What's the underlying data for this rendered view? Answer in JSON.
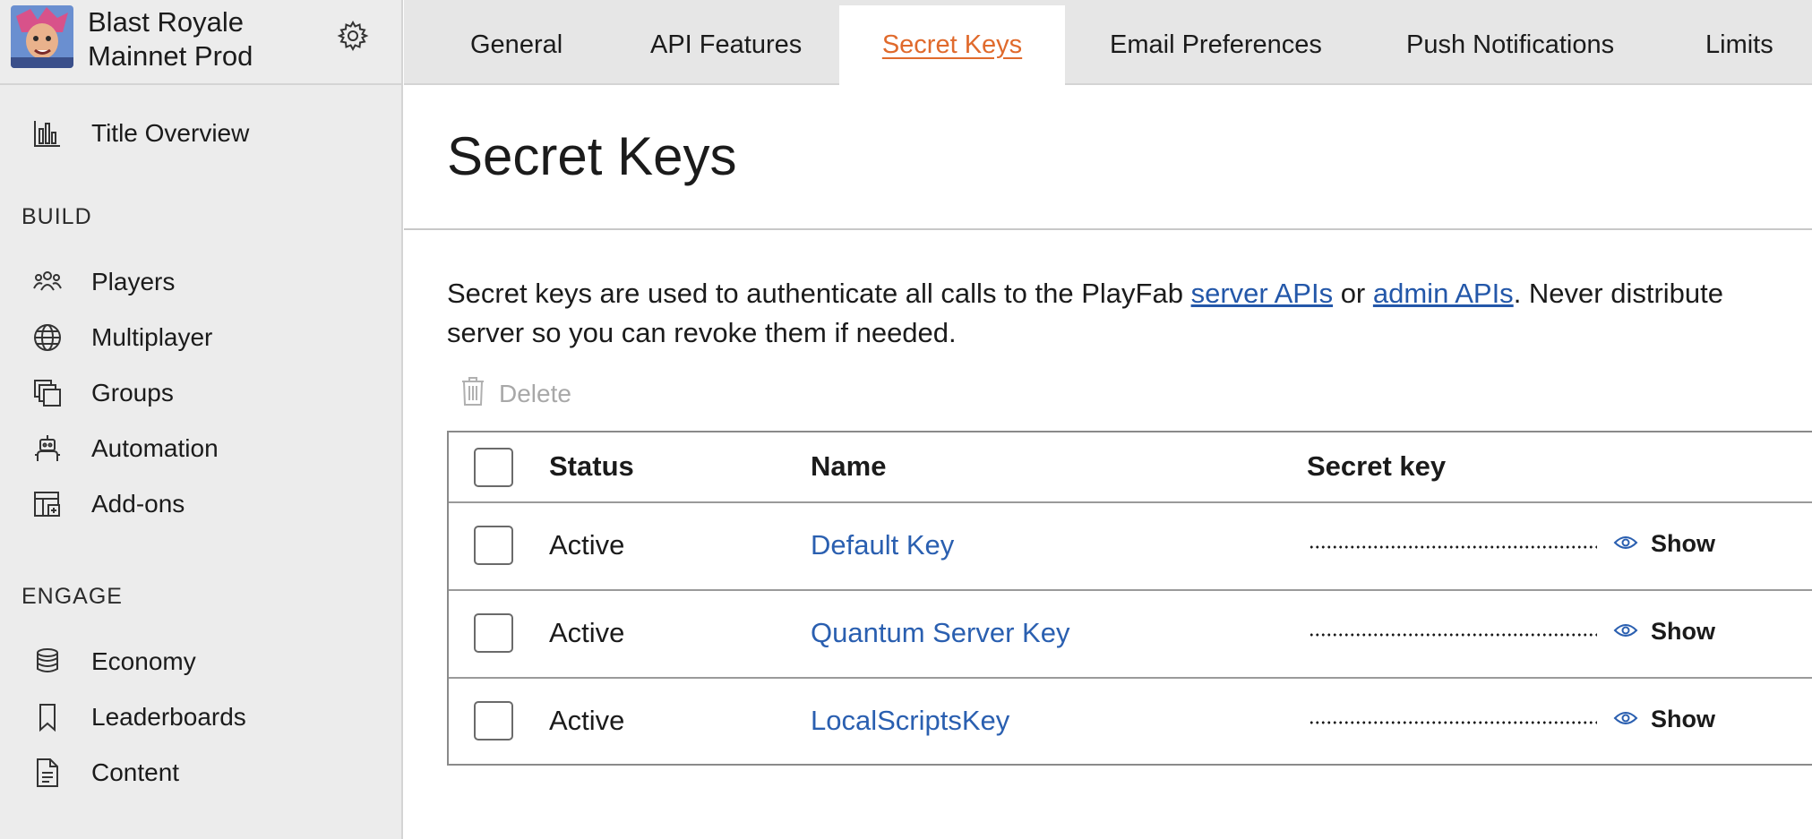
{
  "app": {
    "title_line1": "Blast Royale",
    "title_line2": "Mainnet Prod"
  },
  "sidebar": {
    "overview_label": "Title Overview",
    "build_heading": "BUILD",
    "build_items": [
      {
        "label": "Players",
        "icon": "players-icon"
      },
      {
        "label": "Multiplayer",
        "icon": "globe-icon"
      },
      {
        "label": "Groups",
        "icon": "groups-icon"
      },
      {
        "label": "Automation",
        "icon": "robot-icon"
      },
      {
        "label": "Add-ons",
        "icon": "addons-icon"
      }
    ],
    "engage_heading": "ENGAGE",
    "engage_items": [
      {
        "label": "Economy",
        "icon": "coins-icon"
      },
      {
        "label": "Leaderboards",
        "icon": "bookmark-icon"
      },
      {
        "label": "Content",
        "icon": "document-icon"
      }
    ]
  },
  "tabs": [
    {
      "label": "General",
      "active": false
    },
    {
      "label": "API Features",
      "active": false
    },
    {
      "label": "Secret Keys",
      "active": true
    },
    {
      "label": "Email Preferences",
      "active": false
    },
    {
      "label": "Push Notifications",
      "active": false
    },
    {
      "label": "Limits",
      "active": false
    }
  ],
  "main": {
    "page_title": "Secret Keys",
    "desc_part1": "Secret keys are used to authenticate all calls to the PlayFab ",
    "desc_link1": "server APIs",
    "desc_part2": " or ",
    "desc_link2": "admin APIs",
    "desc_part3": ". Never distribute",
    "desc_line2": "server so you can revoke them if needed.",
    "delete_label": "Delete"
  },
  "table": {
    "headers": {
      "status": "Status",
      "name": "Name",
      "secret": "Secret key"
    },
    "show_label": "Show",
    "rows": [
      {
        "status": "Active",
        "name": "Default Key"
      },
      {
        "status": "Active",
        "name": "Quantum Server Key"
      },
      {
        "status": "Active",
        "name": "LocalScriptsKey"
      }
    ]
  },
  "colors": {
    "accent": "#e06a2c",
    "link": "#2a5fb0",
    "sidebar_bg": "#ececec",
    "tabbar_bg": "#e6e6e6"
  }
}
